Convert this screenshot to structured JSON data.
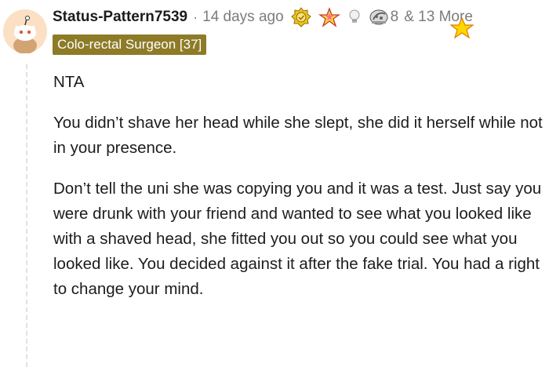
{
  "comment": {
    "username": "Status-Pattern7539",
    "separator": "·",
    "timestamp": "14 days ago",
    "award_count": "8",
    "more_awards": "& 13 More",
    "flair": "Colo-rectal Surgeon [37]",
    "paragraphs": [
      "NTA",
      "You didn’t shave her head while she slept, she did it herself while not in your presence.",
      "Don’t tell the uni she was copying you and it was a test. Just say you were drunk with your friend and wanted to see what you looked like with a shaved head, she fitted you out so you could see what you looked like. You decided against it after the fake trial. You had a right to change your mind."
    ]
  },
  "icons": [
    "avatar",
    "gold-award-icon",
    "star-award-icon",
    "lightbulb-icon",
    "rocket-award-icon",
    "gold-star-icon"
  ],
  "colors": {
    "flair_bg": "#8d7b27",
    "flair_text": "#ffffff",
    "meta_text": "#7c7c7c",
    "avatar_bg": "#fbe0c4"
  }
}
